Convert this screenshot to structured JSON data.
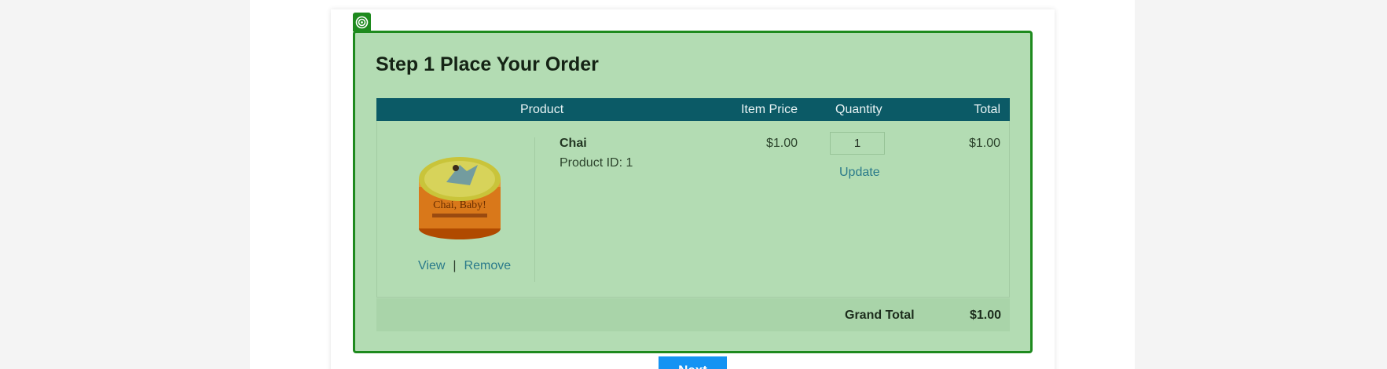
{
  "step": {
    "title": "Step 1 Place Your Order"
  },
  "table": {
    "headers": {
      "product": "Product",
      "item_price": "Item Price",
      "quantity": "Quantity",
      "total": "Total"
    },
    "rows": [
      {
        "name": "Chai",
        "product_id": "Product ID: 1",
        "image_label": "Chai, Baby!",
        "price": "$1.00",
        "quantity": "1",
        "update_label": "Update",
        "total": "$1.00",
        "view_label": "View",
        "separator": "|",
        "remove_label": "Remove"
      }
    ],
    "grand_total_label": "Grand Total",
    "grand_total_value": "$1.00"
  },
  "actions": {
    "next_label": "Next"
  },
  "colors": {
    "highlight_fill": "#b3dcb3",
    "highlight_border": "#1e8a1e",
    "header_bg": "#0b5a66",
    "link": "#2a7a8a",
    "next_button": "#1493f3"
  },
  "icons": {
    "target": "target-icon"
  }
}
